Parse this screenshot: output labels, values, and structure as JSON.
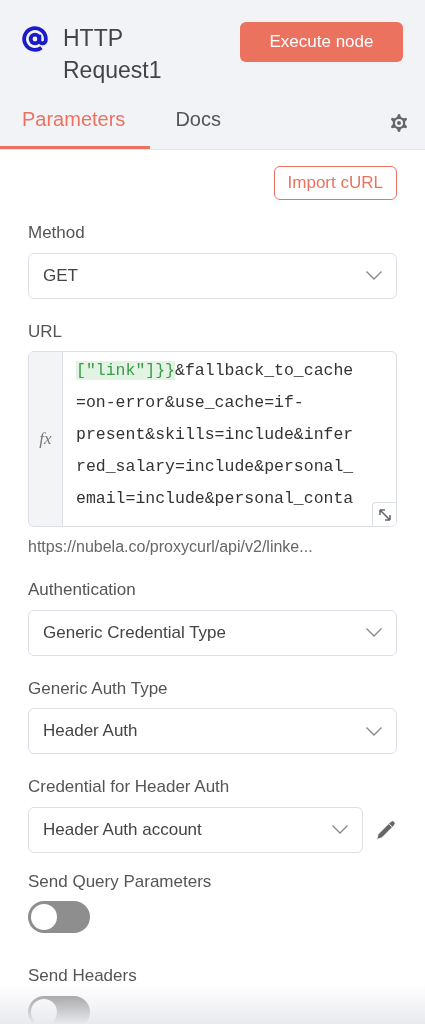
{
  "node": {
    "title": "HTTP Request1",
    "execute_button": "Execute node"
  },
  "tabs": [
    {
      "label": "Parameters",
      "selected": true
    },
    {
      "label": "Docs",
      "selected": false
    }
  ],
  "import_button": "Import cURL",
  "fields": [
    {
      "kind": "select",
      "label": "Method",
      "value": "GET"
    },
    {
      "kind": "expression",
      "label": "URL",
      "highlight": "[\"link\"]}}",
      "lines": [
        "&fallback_to_cache",
        "=on-error&use_cache=if-",
        "present&skills=include&infer",
        "red_salary=include&personal_",
        "email=include&personal_conta"
      ],
      "fx": "fx",
      "hint": "https://nubela.co/proxycurl/api/v2/linke..."
    },
    {
      "kind": "select",
      "label": "Authentication",
      "value": "Generic Credential Type"
    },
    {
      "kind": "select",
      "label": "Generic Auth Type",
      "value": "Header Auth"
    },
    {
      "kind": "credential",
      "label": "Credential for Header Auth",
      "value": "Header Auth account"
    },
    {
      "kind": "toggle",
      "label": "Send Query Parameters",
      "on": false
    },
    {
      "kind": "toggle",
      "label": "Send Headers",
      "on": false
    }
  ]
}
